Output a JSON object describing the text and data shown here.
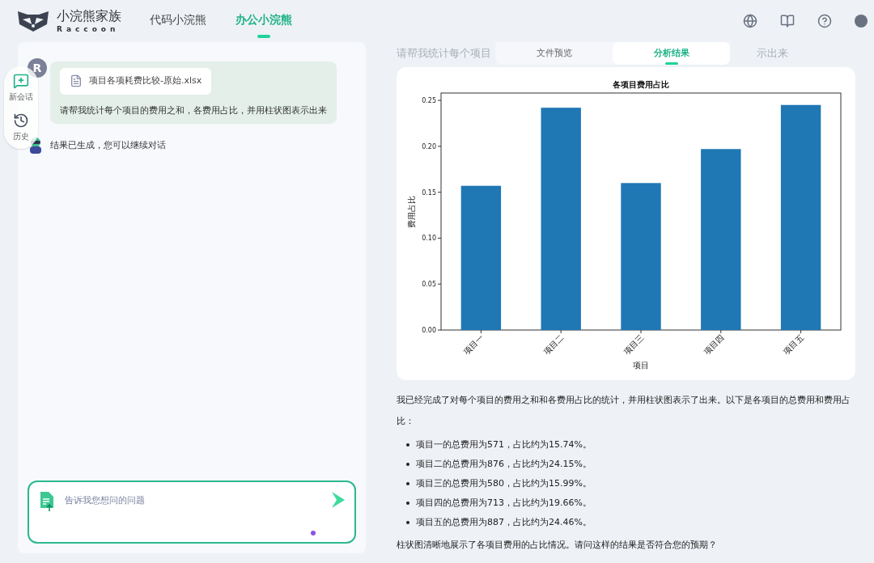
{
  "header": {
    "logo": {
      "title": "小浣熊家族",
      "subtitle": "Raccoon"
    },
    "nav": [
      {
        "label": "代码小浣熊",
        "selected": false
      },
      {
        "label": "办公小浣熊",
        "selected": true
      }
    ]
  },
  "sidebar": {
    "items": [
      {
        "label": "新会话",
        "kind": "new-chat"
      },
      {
        "label": "历史",
        "kind": "history"
      }
    ]
  },
  "chat": {
    "messages": [
      {
        "kind": "user",
        "avatar": "R",
        "file": "项目各项耗费比较-原始.xlsx",
        "text": "请帮我统计每个项目的费用之和，各费用占比，并用柱状图表示出来"
      },
      {
        "kind": "bot",
        "text": "结果已生成，您可以继续对话"
      }
    ],
    "input": {
      "placeholder": "告诉我您想问的问题"
    }
  },
  "result": {
    "faded_title": [
      "请帮我统计每个项目",
      "示出来"
    ],
    "view_tabs": [
      {
        "label": "文件预览",
        "selected": false
      },
      {
        "label": "分析结果",
        "selected": true
      }
    ],
    "chart_data": {
      "type": "bar",
      "title": "各项目费用占比",
      "xlabel": "项目",
      "ylabel": "费用占比",
      "categories": [
        "项目一",
        "项目二",
        "项目三",
        "项目四",
        "项目五"
      ],
      "series": [
        {
          "color": "#1f77b4",
          "values": [
            0.157,
            0.242,
            0.16,
            0.197,
            0.245
          ]
        }
      ],
      "ylim": [
        0,
        0.258
      ],
      "yticks": [
        {
          "value": 0,
          "label": "0.00"
        },
        {
          "value": 0.05,
          "label": "0.05"
        },
        {
          "value": 0.1,
          "label": "0.10"
        },
        {
          "value": 0.15,
          "label": "0.15"
        },
        {
          "value": 0.2,
          "label": "0.20"
        },
        {
          "value": 0.25,
          "label": "0.25"
        }
      ]
    },
    "summary": "我已经完成了对每个项目的费用之和和各费用占比的统计，并用柱状图表示了出来。以下是各项目的总费用和费用占比：",
    "bullets": [
      "项目一的总费用为571，占比约为15.74%。",
      "项目二的总费用为876，占比约为24.15%。",
      "项目三的总费用为580，占比约为15.99%。",
      "项目四的总费用为713，占比约为19.66%。",
      "项目五的总费用为887，占比约为24.46%。"
    ],
    "closing": "柱状图清晰地展示了各项目费用的占比情况。请问这样的结果是否符合您的预期？"
  }
}
